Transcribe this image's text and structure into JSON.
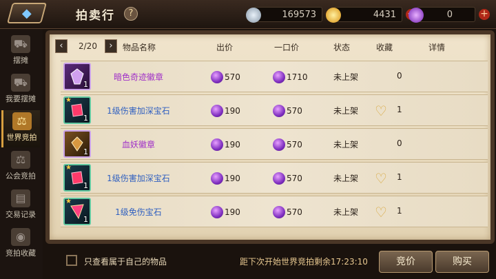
{
  "header": {
    "title": "拍卖行",
    "help": "?",
    "currencies": [
      {
        "name": "silver-coin",
        "value": "169573",
        "color": "#b8c8d8"
      },
      {
        "name": "gold-coin",
        "value": "4431",
        "color": "#e8b020"
      },
      {
        "name": "purple-gem",
        "value": "0",
        "color": "#a050e0"
      }
    ]
  },
  "sidebar": {
    "tabs": [
      {
        "label": "摆摊",
        "icon": "cart-icon"
      },
      {
        "label": "我要摆摊",
        "icon": "stall-icon"
      },
      {
        "label": "世界竞拍",
        "icon": "scale-icon"
      },
      {
        "label": "公会竞拍",
        "icon": "guild-scale-icon"
      },
      {
        "label": "交易记录",
        "icon": "record-icon"
      },
      {
        "label": "竞拍收藏",
        "icon": "favorite-icon"
      }
    ]
  },
  "table": {
    "page": "2/20",
    "columns": [
      "物品名称",
      "出价",
      "一口价",
      "状态",
      "收藏",
      "详情"
    ],
    "rows": [
      {
        "name": "暗色奇迹徽章",
        "color": "#a030c8",
        "bid": "570",
        "buyout": "1710",
        "status": "未上架",
        "fav": "0",
        "qty": "1",
        "icon": "badge-icon"
      },
      {
        "name": "1级伤害加深宝石",
        "color": "#3060c0",
        "bid": "190",
        "buyout": "570",
        "status": "未上架",
        "fav": "1",
        "qty": "1",
        "icon": "red-gem-icon"
      },
      {
        "name": "血妖徽章",
        "color": "#a030c8",
        "bid": "190",
        "buyout": "570",
        "status": "未上架",
        "fav": "0",
        "qty": "1",
        "icon": "blood-badge-icon"
      },
      {
        "name": "1级伤害加深宝石",
        "color": "#3060c0",
        "bid": "190",
        "buyout": "570",
        "status": "未上架",
        "fav": "1",
        "qty": "1",
        "icon": "red-gem-icon"
      },
      {
        "name": "1级免伤宝石",
        "color": "#3060c0",
        "bid": "190",
        "buyout": "570",
        "status": "未上架",
        "fav": "1",
        "qty": "1",
        "icon": "prism-gem-icon"
      }
    ]
  },
  "footer": {
    "checkbox_label": "只查看属于自己的物品",
    "timer": "距下次开始世界竞拍剩余17:23:10",
    "bid_button": "竞价",
    "buy_button": "购买"
  }
}
